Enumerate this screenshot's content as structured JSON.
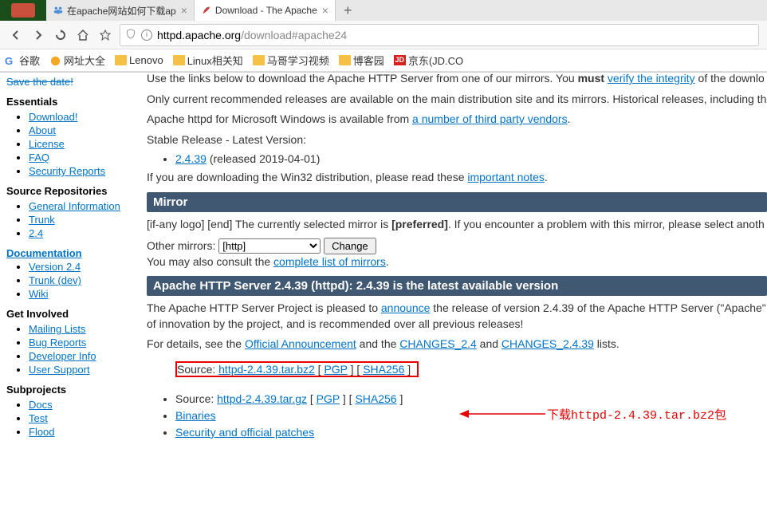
{
  "browser": {
    "tabs": [
      {
        "title": "在apache网站如何下载ap"
      },
      {
        "title": "Download - The Apache"
      }
    ],
    "url_host": "httpd.apache.org",
    "url_path": "/download#apache24",
    "new_tab": "+",
    "close": "×"
  },
  "bookmarks": {
    "items": [
      "谷歌",
      "网址大全",
      "Lenovo",
      "Linux相关知",
      "马哥学习视频",
      "博客园",
      "京东(JD.CO"
    ]
  },
  "sidebar": {
    "save_date": "Save the date!",
    "essentials": {
      "title": "Essentials",
      "items": [
        "Download!",
        "About",
        "License",
        "FAQ",
        "Security Reports"
      ]
    },
    "source_repos": {
      "title": "Source Repositories",
      "items": [
        "General Information",
        "Trunk",
        "2.4"
      ]
    },
    "documentation": {
      "title": "Documentation",
      "items": [
        "Version 2.4",
        "Trunk (dev)",
        "Wiki"
      ]
    },
    "get_involved": {
      "title": "Get Involved",
      "items": [
        "Mailing Lists",
        "Bug Reports",
        "Developer Info",
        "User Support"
      ]
    },
    "subprojects": {
      "title": "Subprojects",
      "items": [
        "Docs",
        "Test",
        "Flood"
      ]
    }
  },
  "main": {
    "truncated_top": "Use the links below to download the Apache HTTP Server from one of our mirrors. You ",
    "must": "must",
    "verify_link": "verify the integrity",
    "truncated_top2": " of the downlo",
    "recommended": "Only current recommended releases are available on the main distribution site and its mirrors. Historical releases, including th",
    "windows_pre": "Apache httpd for Microsoft Windows is available from ",
    "windows_link": "a number of third party vendors",
    "stable_release": "Stable Release - Latest Version:",
    "version_link": "2.4.39",
    "version_date": " (released 2019-04-01)",
    "win32_pre": "If you are downloading the Win32 distribution, please read these ",
    "win32_link": "important notes",
    "mirror_header": "Mirror",
    "mirror_text1": "[if-any logo] [end] The currently selected mirror is ",
    "preferred": "[preferred]",
    "mirror_text2": ". If you encounter a problem with this mirror, please select anoth",
    "other_mirrors": "Other mirrors:",
    "mirror_option": "[http]",
    "change_btn": "Change",
    "consult_pre": "You may also consult the ",
    "consult_link": "complete list of mirrors",
    "apache_header": "Apache HTTP Server 2.4.39 (httpd): 2.4.39 is the latest available version",
    "pleased_pre": "The Apache HTTP Server Project is pleased to ",
    "announce": "announce",
    "pleased_post": " the release of version 2.4.39 of the Apache HTTP Server (\"Apache\"",
    "innovation": "of innovation by the project, and is recommended over all previous releases!",
    "details_pre": "For details, see the ",
    "official": "Official Announcement",
    "and1": " and the ",
    "changes24": "CHANGES_2.4",
    "and2": " and ",
    "changes2439": "CHANGES_2.4.39",
    "lists": " lists.",
    "source1_pre": "Source: ",
    "source1_file": "httpd-2.4.39.tar.bz2",
    "pgp": "PGP",
    "sha256": "SHA256",
    "source2_file": "httpd-2.4.39.tar.gz",
    "binaries": "Binaries",
    "security": "Security and official patches",
    "annotation": "下载httpd-2.4.39.tar.bz2包"
  }
}
